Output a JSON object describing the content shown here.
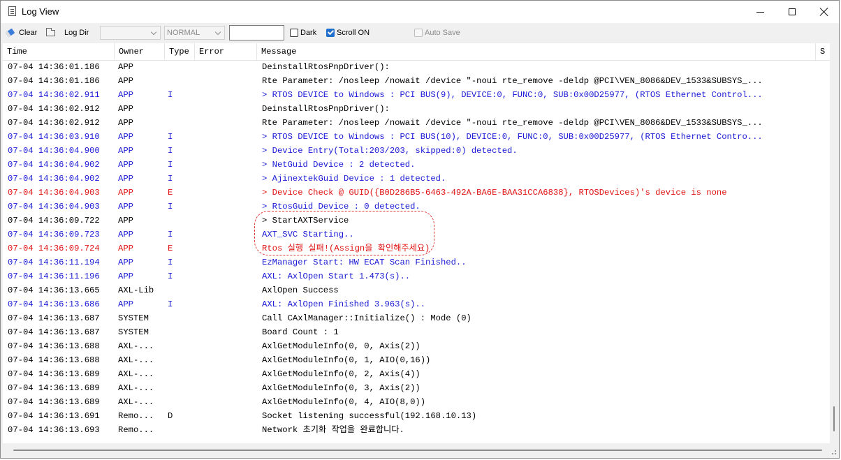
{
  "window": {
    "title": "Log View"
  },
  "toolbar": {
    "clear_label": "Clear",
    "log_dir_label": "Log Dir",
    "combo1_value": "",
    "combo2_value": "NORMAL",
    "filter_value": "",
    "dark_label": "Dark",
    "dark_checked": false,
    "scroll_on_label": "Scroll ON",
    "scroll_on_checked": true,
    "auto_save_label": "Auto Save",
    "auto_save_enabled": false
  },
  "table": {
    "columns": [
      "Time",
      "Owner",
      "Type",
      "Error",
      "Message",
      "S"
    ],
    "rows": [
      {
        "time": "07-04 14:36:01.186",
        "owner": "APP",
        "type": "",
        "error": "",
        "message": "DeinstallRtosPnpDriver():",
        "color": "black"
      },
      {
        "time": "07-04 14:36:01.186",
        "owner": "APP",
        "type": "",
        "error": "",
        "message": "Rte Parameter: /nosleep /nowait /device \"-noui rte_remove -deldp @PCI\\VEN_8086&DEV_1533&SUBSYS_...",
        "color": "black"
      },
      {
        "time": "07-04 14:36:02.911",
        "owner": "APP",
        "type": "I",
        "error": "",
        "message": "> RTOS DEVICE to Windows : PCI BUS(9), DEVICE:0, FUNC:0, SUB:0x00D25977, (RTOS Ethernet Control...",
        "color": "blue"
      },
      {
        "time": "07-04 14:36:02.912",
        "owner": "APP",
        "type": "",
        "error": "",
        "message": "DeinstallRtosPnpDriver():",
        "color": "black"
      },
      {
        "time": "07-04 14:36:02.912",
        "owner": "APP",
        "type": "",
        "error": "",
        "message": "Rte Parameter: /nosleep /nowait /device \"-noui rte_remove -deldp @PCI\\VEN_8086&DEV_1533&SUBSYS_...",
        "color": "black"
      },
      {
        "time": "07-04 14:36:03.910",
        "owner": "APP",
        "type": "I",
        "error": "",
        "message": "> RTOS DEVICE to Windows : PCI BUS(10), DEVICE:0, FUNC:0, SUB:0x00D25977, (RTOS Ethernet Contro...",
        "color": "blue"
      },
      {
        "time": "07-04 14:36:04.900",
        "owner": "APP",
        "type": "I",
        "error": "",
        "message": "> Device Entry(Total:203/203, skipped:0) detected.",
        "color": "blue"
      },
      {
        "time": "07-04 14:36:04.902",
        "owner": "APP",
        "type": "I",
        "error": "",
        "message": "> NetGuid Device : 2 detected.",
        "color": "blue"
      },
      {
        "time": "07-04 14:36:04.902",
        "owner": "APP",
        "type": "I",
        "error": "",
        "message": "> AjinextekGuid Device : 1 detected.",
        "color": "blue"
      },
      {
        "time": "07-04 14:36:04.903",
        "owner": "APP",
        "type": "E",
        "error": "",
        "message": "> Device Check @ GUID({B0D286B5-6463-492A-BA6E-BAA31CCA6838}, RTOSDevices)'s device is none",
        "color": "red"
      },
      {
        "time": "07-04 14:36:04.903",
        "owner": "APP",
        "type": "I",
        "error": "",
        "message": "> RtosGuid Device : 0 detected.",
        "color": "blue"
      },
      {
        "time": "07-04 14:36:09.722",
        "owner": "APP",
        "type": "",
        "error": "",
        "message": "> StartAXTService",
        "color": "black"
      },
      {
        "time": "07-04 14:36:09.723",
        "owner": "APP",
        "type": "I",
        "error": "",
        "message": "AXT_SVC Starting..",
        "color": "blue"
      },
      {
        "time": "07-04 14:36:09.724",
        "owner": "APP",
        "type": "E",
        "error": "",
        "message": "Rtos 실행 실패!(Assign을 확인해주세요)",
        "color": "red"
      },
      {
        "time": "07-04 14:36:11.194",
        "owner": "APP",
        "type": "I",
        "error": "",
        "message": "EzManager Start: HW ECAT Scan Finished..",
        "color": "blue"
      },
      {
        "time": "07-04 14:36:11.196",
        "owner": "APP",
        "type": "I",
        "error": "",
        "message": "AXL: AxlOpen Start 1.473(s)..",
        "color": "blue"
      },
      {
        "time": "07-04 14:36:13.665",
        "owner": "AXL-Lib",
        "type": "",
        "error": "",
        "message": "AxlOpen Success",
        "color": "black"
      },
      {
        "time": "07-04 14:36:13.686",
        "owner": "APP",
        "type": "I",
        "error": "",
        "message": "AXL: AxlOpen Finished 3.963(s)..",
        "color": "blue"
      },
      {
        "time": "07-04 14:36:13.687",
        "owner": "SYSTEM",
        "type": "",
        "error": "",
        "message": "Call CAxlManager::Initialize() : Mode (0)",
        "color": "black"
      },
      {
        "time": "07-04 14:36:13.687",
        "owner": "SYSTEM",
        "type": "",
        "error": "",
        "message": "Board Count : 1",
        "color": "black"
      },
      {
        "time": "07-04 14:36:13.688",
        "owner": "AXL-...",
        "type": "",
        "error": "",
        "message": "AxlGetModuleInfo(0, 0, Axis(2))",
        "color": "black"
      },
      {
        "time": "07-04 14:36:13.688",
        "owner": "AXL-...",
        "type": "",
        "error": "",
        "message": "AxlGetModuleInfo(0, 1, AIO(0,16))",
        "color": "black"
      },
      {
        "time": "07-04 14:36:13.689",
        "owner": "AXL-...",
        "type": "",
        "error": "",
        "message": "AxlGetModuleInfo(0, 2, Axis(4))",
        "color": "black"
      },
      {
        "time": "07-04 14:36:13.689",
        "owner": "AXL-...",
        "type": "",
        "error": "",
        "message": "AxlGetModuleInfo(0, 3, Axis(2))",
        "color": "black"
      },
      {
        "time": "07-04 14:36:13.689",
        "owner": "AXL-...",
        "type": "",
        "error": "",
        "message": "AxlGetModuleInfo(0, 4, AIO(8,0))",
        "color": "black"
      },
      {
        "time": "07-04 14:36:13.691",
        "owner": "Remo...",
        "type": "D",
        "error": "",
        "message": "Socket listening successful(192.168.10.13)",
        "color": "black"
      },
      {
        "time": "07-04 14:36:13.693",
        "owner": "Remo...",
        "type": "",
        "error": "",
        "message": "Network 초기화 작업을 완료합니다.",
        "color": "black"
      }
    ]
  },
  "colors": {
    "info": "#1a1ad6",
    "error": "#e11414",
    "normal": "#000000",
    "highlight": "#e23a3a"
  }
}
